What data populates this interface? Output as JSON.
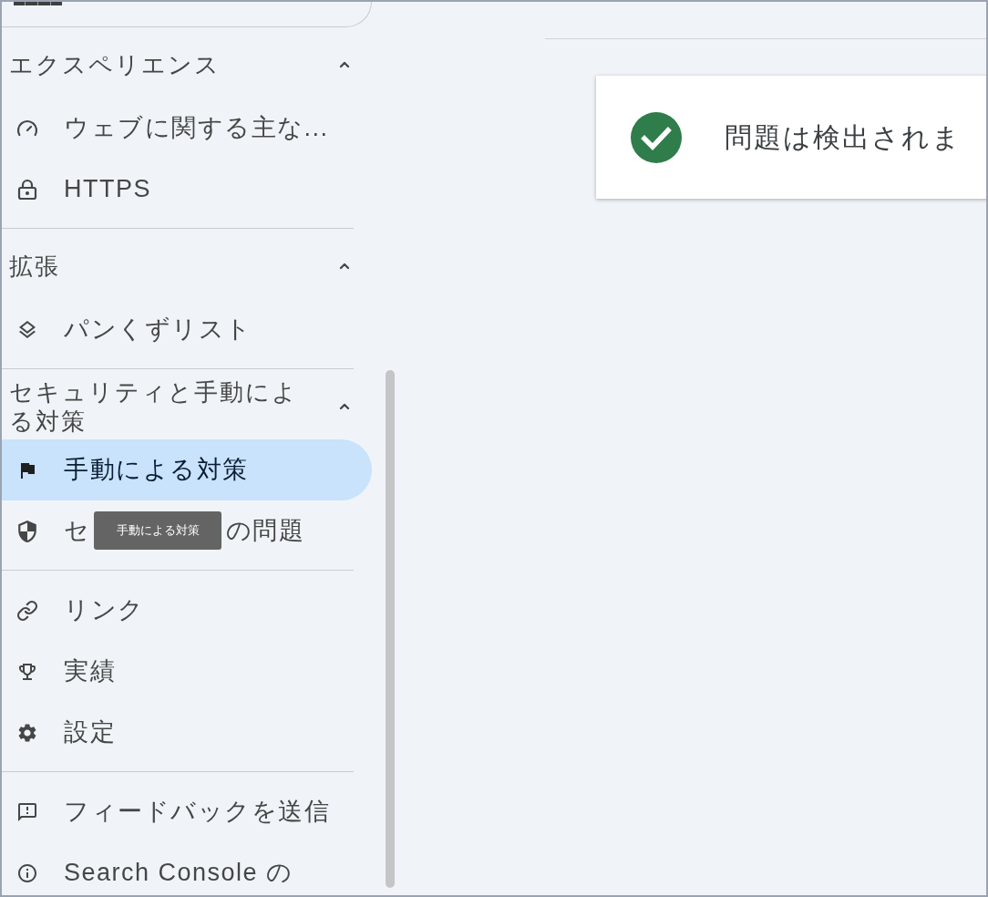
{
  "sidebar": {
    "sections": [
      {
        "title": "エクスペリエンス",
        "expanded": true,
        "items": [
          {
            "label": "ウェブに関する主な...",
            "selected": false
          },
          {
            "label": "HTTPS",
            "selected": false
          }
        ]
      },
      {
        "title": "拡張",
        "expanded": true,
        "items": [
          {
            "label": "パンくずリスト",
            "selected": false
          }
        ]
      },
      {
        "title": "セキュリティと手動による対策",
        "expanded": true,
        "items": [
          {
            "label": "手動による対策",
            "selected": true
          },
          {
            "label_parts": [
              "セ",
              "の問題"
            ],
            "tooltip": "手動による対策",
            "selected": false
          }
        ]
      },
      {
        "items": [
          {
            "label": "リンク",
            "selected": false
          },
          {
            "label": "実績",
            "selected": false
          },
          {
            "label": "設定",
            "selected": false
          }
        ]
      },
      {
        "items": [
          {
            "label": "フィードバックを送信",
            "selected": false
          },
          {
            "label": "Search Console の",
            "selected": false
          }
        ]
      }
    ]
  },
  "status_card": {
    "passed": true,
    "message": "問題は検出されま"
  }
}
